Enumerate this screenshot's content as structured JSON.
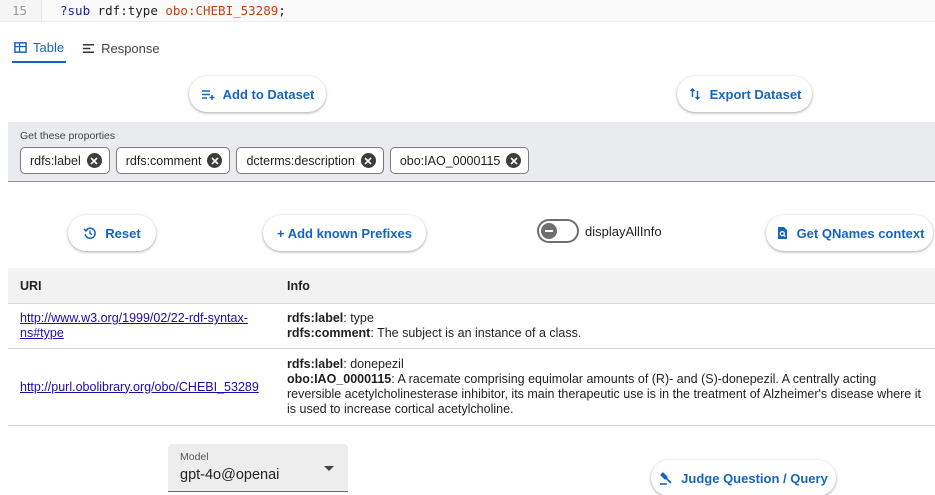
{
  "editor": {
    "line_number": "15",
    "code_var": "?sub",
    "code_rest_1": " rdf:type ",
    "code_prefixed": "obo:CHEBI_53289",
    "code_end": ";"
  },
  "tabs": [
    {
      "label": "Table",
      "icon": "table-icon",
      "active": true
    },
    {
      "label": "Response",
      "icon": "lines-icon",
      "active": false
    }
  ],
  "buttons": {
    "add_to_dataset": "Add to Dataset",
    "export_dataset": "Export Dataset",
    "reset": "Reset",
    "add_known_prefixes": "+ Add known Prefixes",
    "get_qnames_context": "Get QNames context",
    "judge": "Judge Question / Query"
  },
  "properties": {
    "caption": "Get these proporties",
    "chips": [
      "rdfs:label",
      "rdfs:comment",
      "dcterms:description",
      "obo:IAO_0000115"
    ]
  },
  "toggle": {
    "label": "displayAllInfo",
    "on": false
  },
  "table": {
    "headers": {
      "uri": "URI",
      "info": "Info"
    },
    "rows": [
      {
        "uri_line1": "http://www.w3.org/1999/02/22-rdf-syntax-",
        "uri_line2": "ns#type",
        "info": [
          {
            "key": "rdfs:label",
            "value": ": type"
          },
          {
            "key": "rdfs:comment",
            "value": ": The subject is an instance of a class."
          }
        ]
      },
      {
        "uri_line1": "http://purl.obolibrary.org/obo/CHEBI_53289",
        "info": [
          {
            "key": "rdfs:label",
            "value": ": donepezil"
          },
          {
            "key": "obo:IAO_0000115",
            "value": ": A racemate comprising equimolar amounts of (R)- and (S)-donepezil. A centrally acting reversible acetylcholinesterase inhibitor, its main therapeutic use is in the treatment of Alzheimer's disease where it is used to increase cortical acetylcholine."
          }
        ]
      }
    ]
  },
  "model": {
    "label": "Model",
    "value": "gpt-4o@openai"
  },
  "colors": {
    "accent": "#1565c0",
    "link": "#1a0dab",
    "props_bg": "#e9ebef"
  }
}
